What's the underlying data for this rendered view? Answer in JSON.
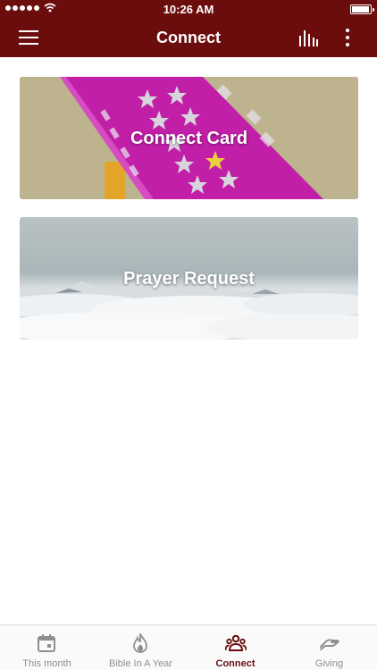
{
  "status_bar": {
    "time": "10:26 AM",
    "signal_bars": 5,
    "battery_level": 0.95
  },
  "header": {
    "title": "Connect"
  },
  "cards": [
    {
      "title": "Connect Card",
      "image": "vip-card-photo"
    },
    {
      "title": "Prayer Request",
      "image": "clouds-mountains-photo"
    }
  ],
  "tabs": [
    {
      "label": "This month",
      "icon": "calendar-icon",
      "active": false
    },
    {
      "label": "Bible In A Year",
      "icon": "flame-icon",
      "active": false
    },
    {
      "label": "Connect",
      "icon": "people-icon",
      "active": true
    },
    {
      "label": "Giving",
      "icon": "hand-icon",
      "active": false
    }
  ],
  "colors": {
    "brand": "#6b0d0d",
    "inactive_tab": "#8f8f8f",
    "card_magenta": "#c21fa8"
  }
}
